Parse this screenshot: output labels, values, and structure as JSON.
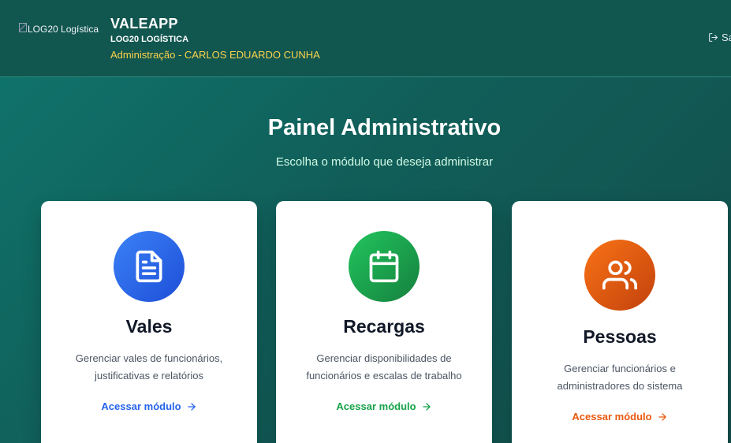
{
  "header": {
    "logo_alt": "LOG20 Logística",
    "app_name": "VALEAPP",
    "company": "LOG20 LOGÍSTICA",
    "role_line": "Administração - CARLOS EDUARDO CUNHA",
    "logout_label": "Sair",
    "role_color": "#fcd34d"
  },
  "hero": {
    "title": "Painel Administrativo",
    "subtitle": "Escolha o módulo que deseja administrar"
  },
  "cards": [
    {
      "title": "Vales",
      "description": "Gerenciar vales de funcionários, justificativas e relatórios",
      "link": "Acessar módulo",
      "icon": "document-icon",
      "color": "#2563eb"
    },
    {
      "title": "Recargas",
      "description": "Gerenciar disponibilidades de funcionários e escalas de trabalho",
      "link": "Acessar módulo",
      "icon": "calendar-icon",
      "color": "#16a34a"
    },
    {
      "title": "Pessoas",
      "description": "Gerenciar funcionários e administradores do sistema",
      "link": "Acessar módulo",
      "icon": "users-icon",
      "color": "#ea580c"
    }
  ]
}
